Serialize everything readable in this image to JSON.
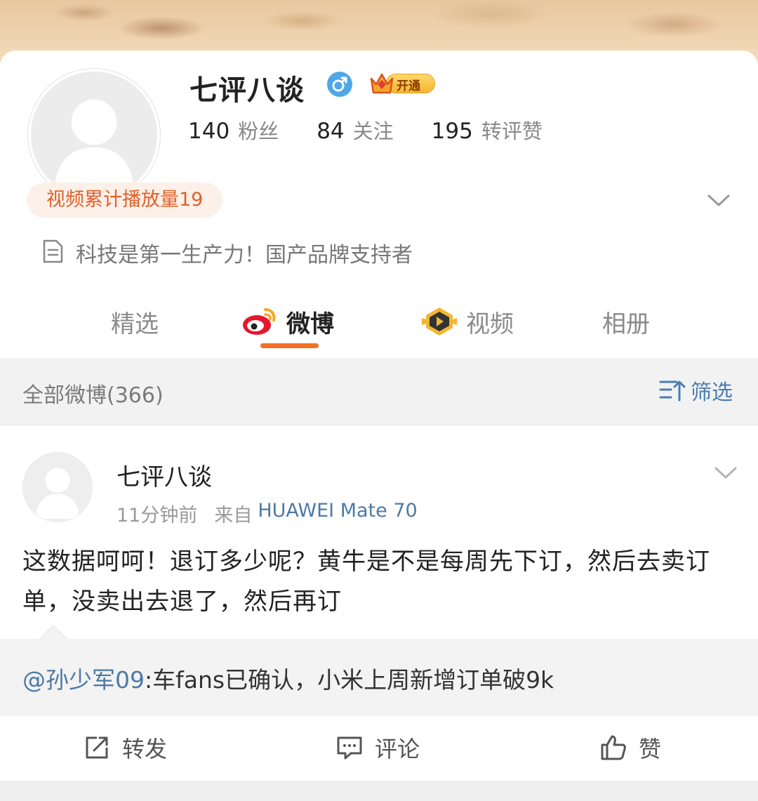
{
  "profile": {
    "name": "七评八谈",
    "vip_label": "开通",
    "stats": [
      {
        "num": "140",
        "label": "粉丝"
      },
      {
        "num": "84",
        "label": "关注"
      },
      {
        "num": "195",
        "label": "转评赞"
      }
    ],
    "video_pill": "视频累计播放量19",
    "bio": "科技是第一生产力！国产品牌支持者"
  },
  "tabs": [
    {
      "label": "精选"
    },
    {
      "label": "微博",
      "active": true
    },
    {
      "label": "视频"
    },
    {
      "label": "相册"
    }
  ],
  "filter_bar": {
    "count_label": "全部微博(366)",
    "filter_label": "筛选"
  },
  "post": {
    "author": "七评八谈",
    "time": "11分钟前",
    "from_label": "来自",
    "device": "HUAWEI Mate 70",
    "text": "这数据呵呵！退订多少呢？黄牛是不是每周先下订，然后去卖订单，没卖出去退了，然后再订",
    "quote": {
      "mention": "@孙少军09",
      "text": ":车fans已确认，小米上周新增订单破9k"
    },
    "actions": {
      "repost": "转发",
      "comment": "评论",
      "like": "赞"
    }
  },
  "colors": {
    "accent": "#f37024",
    "link": "#4d7aa6",
    "pill_text": "#e0612b",
    "pill_bg": "#fdf0e8"
  }
}
